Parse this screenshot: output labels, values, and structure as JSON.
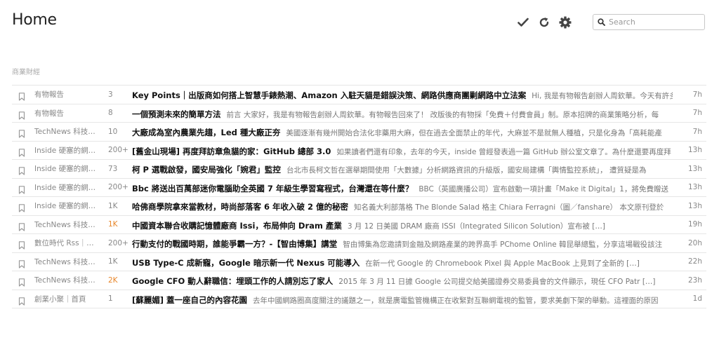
{
  "header": {
    "title": "Home",
    "search_placeholder": "Search"
  },
  "icons": {
    "mark_read": "checkmark-icon",
    "refresh": "refresh-icon",
    "settings": "gear-icon",
    "search": "search-icon",
    "bookmark": "bookmark-icon"
  },
  "colors": {
    "hot_count": "#e8862a"
  },
  "section": {
    "label": "商業財經"
  },
  "articles": [
    {
      "source": "有物報告",
      "count": "3",
      "hot": false,
      "title": "Key Points｜出版商如何搭上智慧手錶熱潮、Amazon 入駐天貓是錯誤決策、網路供應商團剿網路中立法案",
      "snippet": "Hi, 我是有物報告創辦人周欽華。今天有許多",
      "age": "7h"
    },
    {
      "source": "有物報告",
      "count": "8",
      "hot": false,
      "title": "一個預測未來的簡單方法",
      "snippet": "前言 大家好，我是有物報告創辦人周欽華。有物報告回來了！ 改版後的有物採「免費＋付費會員」制。原本招牌的商業策略分析，每",
      "age": "7h"
    },
    {
      "source": "TechNews 科技…",
      "count": "10",
      "hot": false,
      "title": "大廠成為室內農業先趨，Led 種大廠正夯",
      "snippet": "美國逐漸有幾州開始合法化非藥用大麻，但在過去全面禁止的年代，大麻並不是就無人種植，只是化身為「高耗能產",
      "age": "7h"
    },
    {
      "source": "Inside 硬塞的網…",
      "count": "200+",
      "hot": false,
      "title": "[舊金山現場] 再度拜訪章魚貓的家：GitHub 總部 3.0",
      "snippet": "如果讀者們還有印象，去年的今天，inside 曾經發表過一篇 GitHub 辦公室文章了。為什麼還要再度拜",
      "age": "13h"
    },
    {
      "source": "Inside 硬塞的網…",
      "count": "73",
      "hot": false,
      "title": "柯 P 選戰啟發，國安局強化「婉君」監控",
      "snippet": "台北市長柯文哲在選舉期間使用「大數據」分析網路資訊的升級版，國安局建構「輿情監控系統」， 遭質疑是為",
      "age": "13h"
    },
    {
      "source": "Inside 硬塞的網…",
      "count": "200+",
      "hot": false,
      "title": "Bbc 將送出百萬部迷你電腦助全英國 7 年級生學習寫程式，台灣還在等什麼？",
      "snippet": "BBC（英國廣播公司）宣布啟動一項計畫「Make it Digital」1，將免費贈送",
      "age": "13h"
    },
    {
      "source": "Inside 硬塞的網…",
      "count": "1K",
      "hot": false,
      "title": "哈佛商學院拿來當教材，時尚部落客 6 年收入破 2 億的秘密",
      "snippet": "知名義大利部落格 The Blonde Salad 格主 Chiara Ferragni（圖／fanshare） 本文原刊登於",
      "age": "13h"
    },
    {
      "source": "TechNews 科技…",
      "count": "1K",
      "hot": true,
      "title": "中國資本聯合收購記憶體廠商 Issi，布局伸向 Dram 產業",
      "snippet": "3 月 12 日美國 DRAM 廠商 ISSI（Integrated Silicon Solution）宣布被 […]",
      "age": "19h"
    },
    {
      "source": "數位時代 Rss｜…",
      "count": "200+",
      "hot": false,
      "title": "行動支付的戰國時期，誰能爭霸一方？-【智由博集】講堂",
      "snippet": "智由博集為您邀請到金融及網路產業的跨界高手 PChome Online 韓昆舉總監，分享這場戰役該注",
      "age": "20h"
    },
    {
      "source": "TechNews 科技…",
      "count": "1K",
      "hot": false,
      "title": "USB Type-C 成新寵，Google 暗示新一代 Nexus 可能導入",
      "snippet": "在新一代 Google 的 Chromebook Pixel 與 Apple MacBook 上見到了全新的 […]",
      "age": "22h"
    },
    {
      "source": "TechNews 科技…",
      "count": "2K",
      "hot": true,
      "title": "Google CFO 動人辭職信：埋頭工作的人請別忘了家人",
      "snippet": "2015 年 3 月 11 日據 Google 公司提交給美國證券交易委員會的文件顯示，現任 CFO Patr […]",
      "age": "23h"
    },
    {
      "source": "創業小聚｜首頁",
      "count": "1",
      "hot": false,
      "title": "[蘇麗媚] 蓋一座自己的內容花園",
      "snippet": "去年中國網路圈高度關注的議題之一，就是廣電監管機構正在收緊對互聯網電視的監管，要求美劇下架的舉動。這裡面的原因",
      "age": "1d"
    }
  ]
}
